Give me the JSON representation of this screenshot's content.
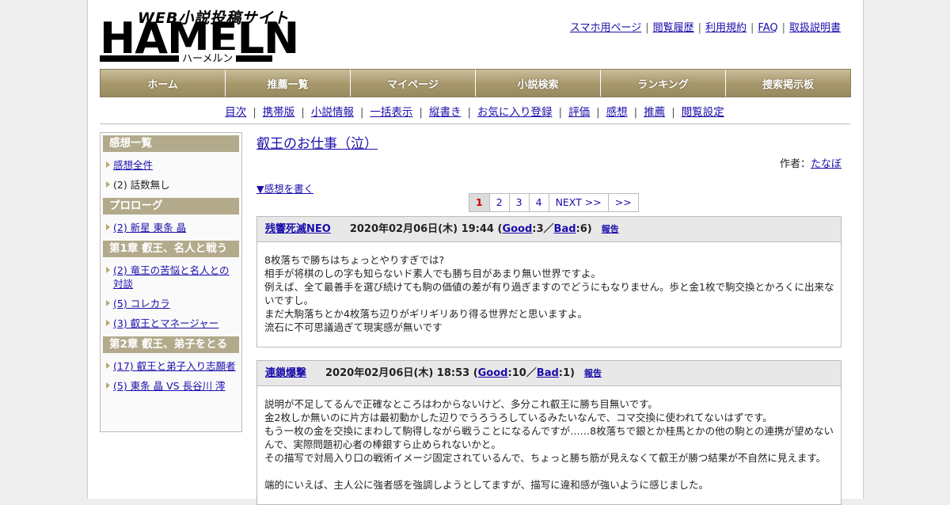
{
  "header": {
    "logo_tagline": "WEB小説投稿サイト",
    "logo_main": "HAMELN",
    "logo_kana": "ハーメルン",
    "top_links": [
      "スマホ用ページ",
      "閲覧履歴",
      "利用規約",
      "FAQ",
      "取扱説明書"
    ]
  },
  "main_nav": [
    "ホーム",
    "推薦一覧",
    "マイページ",
    "小説検索",
    "ランキング",
    "捜索掲示板"
  ],
  "sub_nav": [
    "目次",
    "携帯版",
    "小説情報",
    "一括表示",
    "縦書き",
    "お気に入り登録",
    "評価",
    "感想",
    "推薦",
    "閲覧設定"
  ],
  "sidebar": {
    "sections": [
      {
        "heading": "感想一覧",
        "items": [
          {
            "text": "感想全件",
            "link": true
          },
          {
            "text": "(2) 話数無し",
            "link": false
          }
        ]
      },
      {
        "heading": "プロローグ",
        "items": [
          {
            "text": "(2) 新星 東条 晶",
            "link": true
          }
        ]
      },
      {
        "heading": "第1章 叡王、名人と戦う",
        "items": [
          {
            "text": "(2) 竜王の苦悩と名人との対談",
            "link": true
          },
          {
            "text": "(5) コレカラ",
            "link": true
          },
          {
            "text": "(3) 叡王とマネージャー",
            "link": true
          }
        ]
      },
      {
        "heading": "第2章 叡王、弟子をとる",
        "items": [
          {
            "text": "(17) 叡王と弟子入り志願者",
            "link": true
          },
          {
            "text": "(5) 東条 晶 VS 長谷川 澪",
            "link": true
          }
        ]
      }
    ]
  },
  "content": {
    "title": "叡王のお仕事（泣）",
    "author_label": "作者：",
    "author": "たなぼ",
    "write_review": "▼感想を書く",
    "pager": [
      "1",
      "2",
      "3",
      "4",
      "NEXT >>",
      ">>"
    ],
    "current_page": "1",
    "reviews": [
      {
        "user": "残響死滅NEO",
        "date": "2020年02月06日(木) 19:44",
        "good_label": "Good",
        "good": "3",
        "bad_label": "Bad",
        "bad": "6",
        "report": "報告",
        "lines": [
          "8枚落ちで勝ちはちょっとやりすぎでは?",
          "相手が将棋のしの字も知らないド素人でも勝ち目があまり無い世界ですよ。",
          "例えば、全て最善手を選び続けても駒の価値の差が有り過ぎますのでどうにもなりません。歩と金1枚で駒交換とかろくに出来ないですし。",
          "まだ大駒落ちとか4枚落ち辺りがギリギリあり得る世界だと思いますよ。",
          "流石に不可思議過ぎて現実感が無いです"
        ]
      },
      {
        "user": "連鎖爆撃",
        "date": "2020年02月06日(木) 18:53",
        "good_label": "Good",
        "good": "10",
        "bad_label": "Bad",
        "bad": "1",
        "report": "報告",
        "lines": [
          "説明が不足してるんで正確なところはわからないけど、多分これ叡王に勝ち目無いです。",
          "金2枚しか無いのに片方は最初動かした辺りでうろうろしているみたいなんで、コマ交換に使われてないはずです。",
          "もう一枚の金を交換にまわして駒得しながら戦うことになるんですが……8枚落ちで銀とか桂馬とかの他の駒との連携が望めないんで、実際問題初心者の棒銀すら止められないかと。",
          "その描写で対局入り口の戦術イメージ固定されているんで、ちょっと勝ち筋が見えなくて叡王が勝つ結果が不自然に見えます。",
          "",
          "端的にいえば、主人公に強者感を強調しようとしてますが、描写に違和感が強いように感じました。"
        ]
      }
    ]
  }
}
